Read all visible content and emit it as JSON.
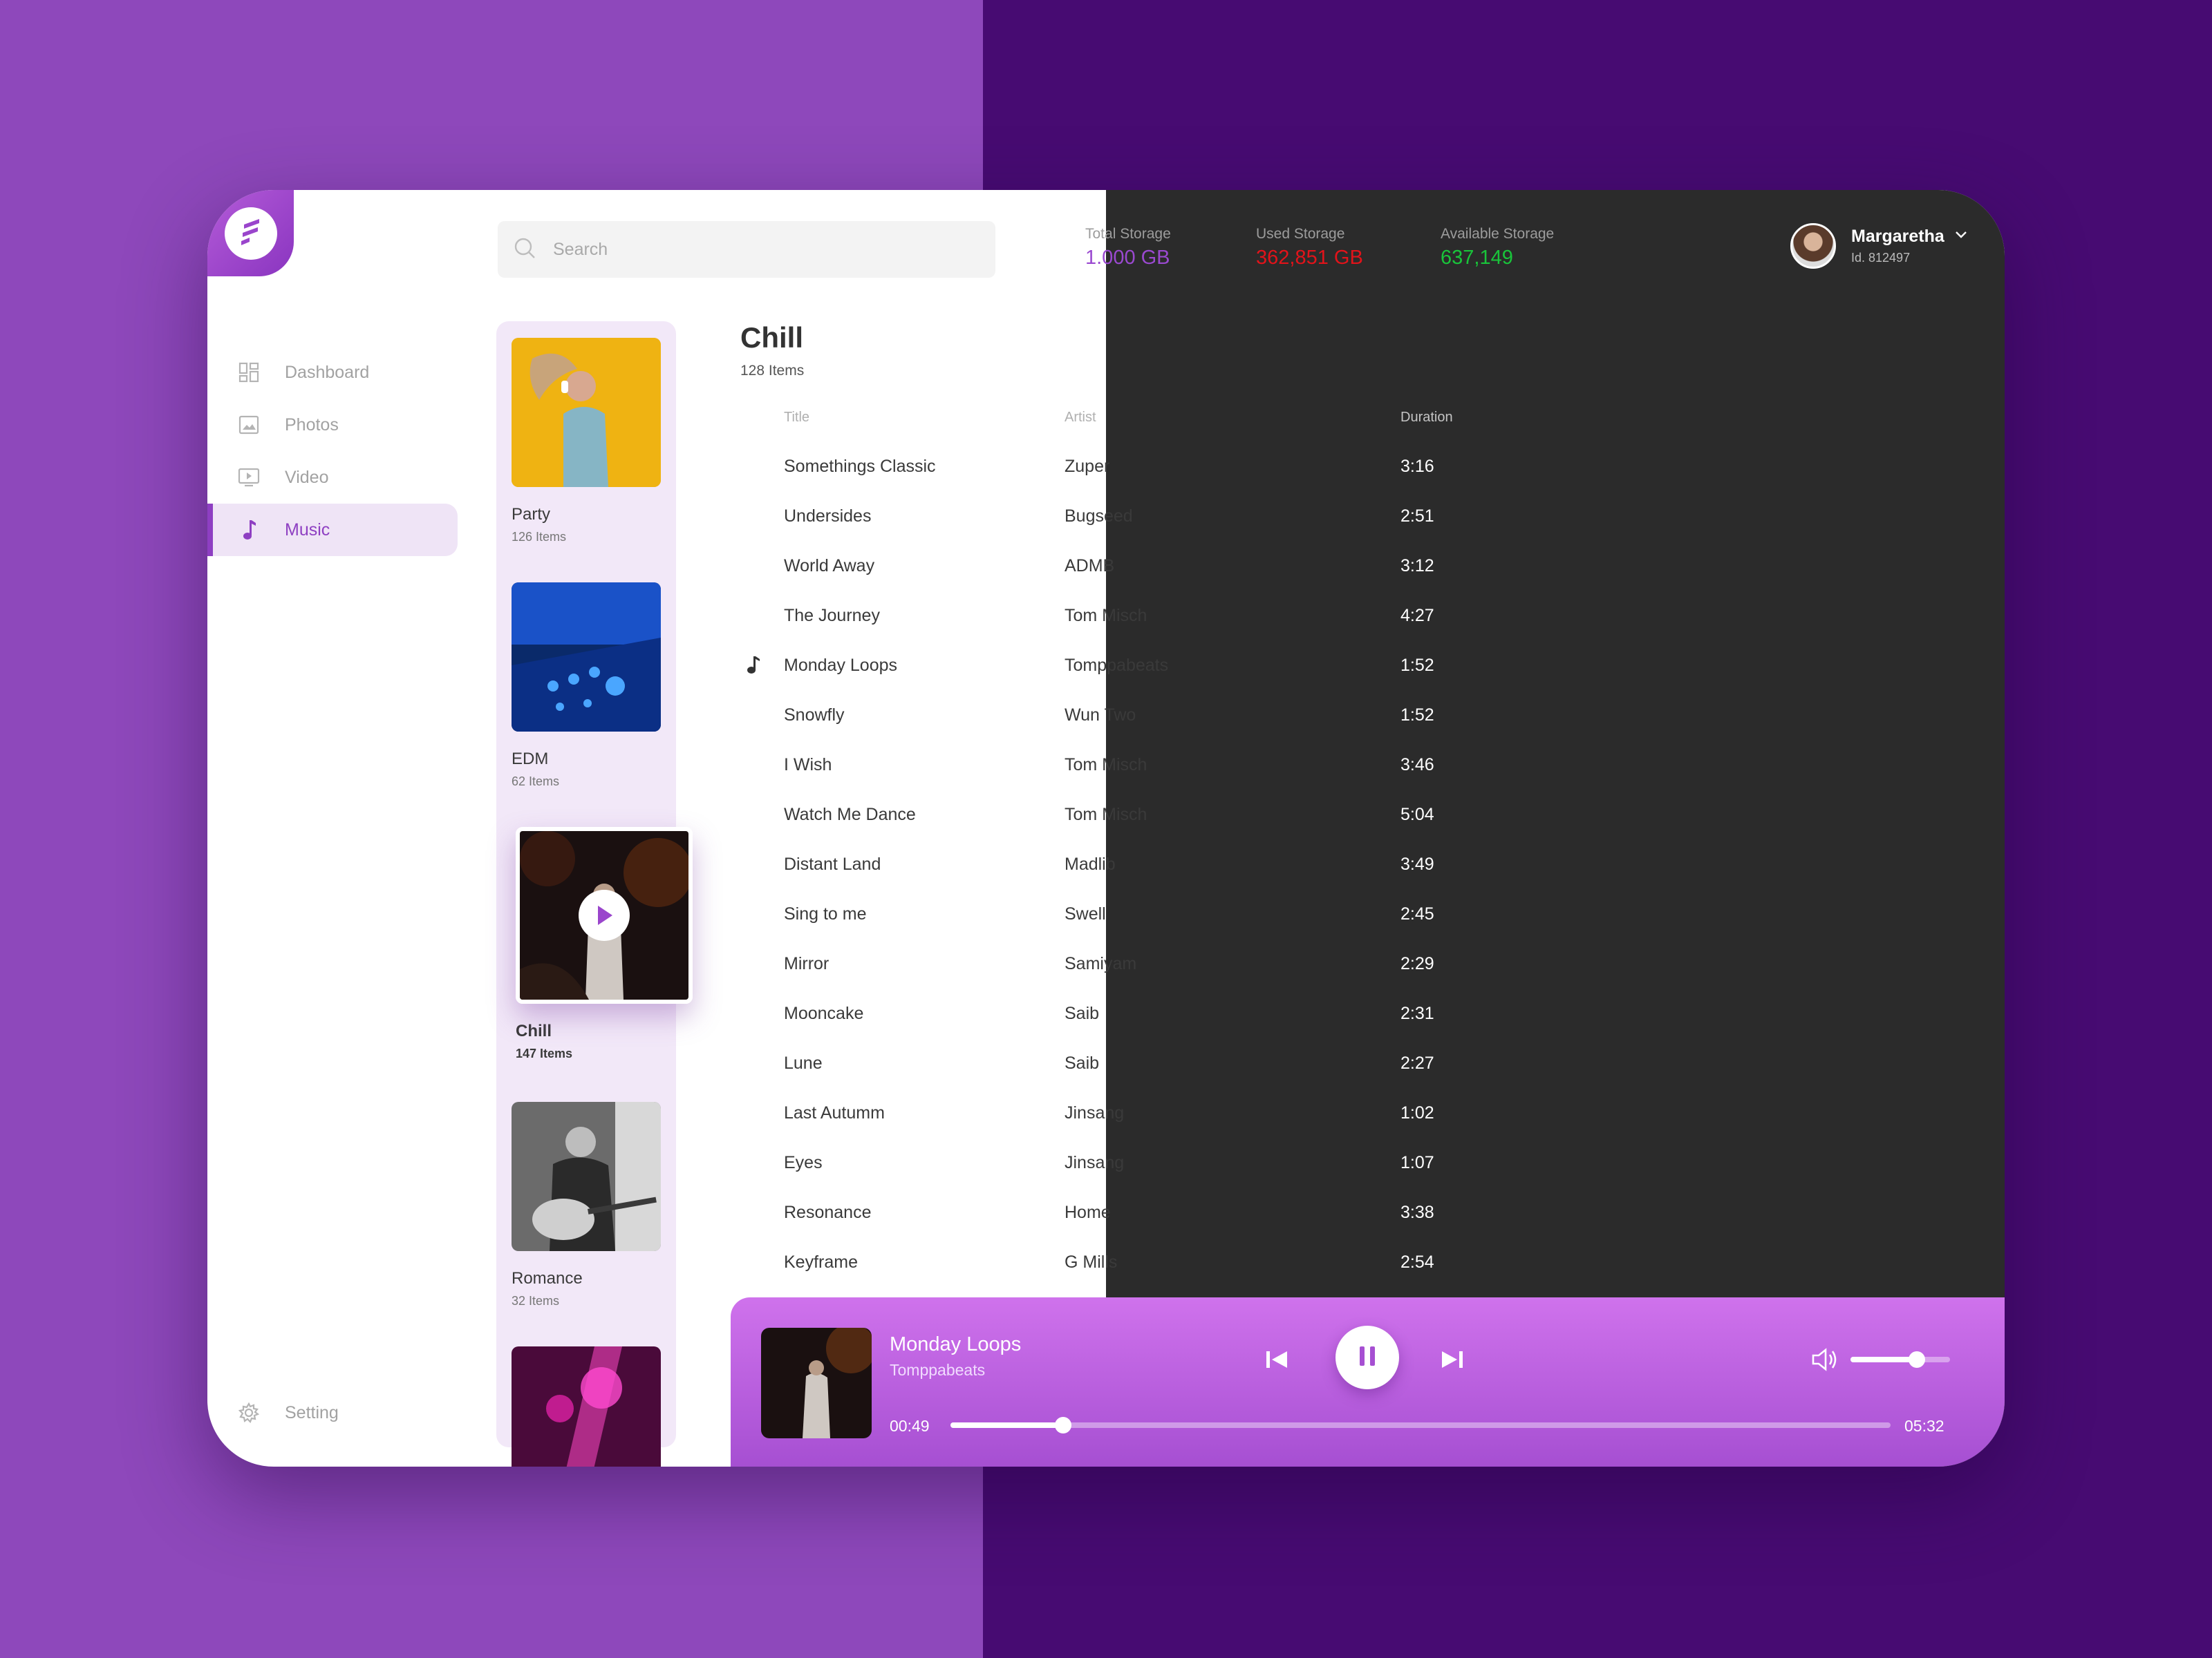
{
  "search": {
    "placeholder": "Search"
  },
  "storage": [
    {
      "label": "Total Storage",
      "value": "1.000 GB",
      "color": "#9a49d0"
    },
    {
      "label": "Used Storage",
      "value": "362,851 GB",
      "color": "#e2131a"
    },
    {
      "label": "Available Storage",
      "value": "637,149",
      "color": "#19c43a"
    }
  ],
  "user": {
    "name": "Margaretha",
    "id": "Id. 812497"
  },
  "sidebar": {
    "items": [
      {
        "label": "Dashboard",
        "icon": "dashboard-icon"
      },
      {
        "label": "Photos",
        "icon": "photo-icon"
      },
      {
        "label": "Video",
        "icon": "video-icon"
      },
      {
        "label": "Music",
        "icon": "music-note-icon",
        "active": true
      }
    ],
    "setting_label": "Setting"
  },
  "playlists": [
    {
      "name": "Party",
      "count": "126 Items"
    },
    {
      "name": "EDM",
      "count": "62 Items"
    },
    {
      "name": "Chill",
      "count": "147 Items",
      "featured": true
    },
    {
      "name": "Romance",
      "count": "32 Items"
    },
    {
      "name": "",
      "count": ""
    }
  ],
  "current": {
    "title": "Chill",
    "count": "128 Items",
    "columns": {
      "title": "Title",
      "artist": "Artist",
      "duration": "Duration"
    },
    "tracks": [
      {
        "title": "Somethings Classic",
        "artist": "Zuper",
        "duration": "3:16"
      },
      {
        "title": "Undersides",
        "artist": "Bugseed",
        "duration": "2:51"
      },
      {
        "title": "World Away",
        "artist": "ADMB",
        "duration": "3:12"
      },
      {
        "title": "The Journey",
        "artist": "Tom Misch",
        "duration": "4:27"
      },
      {
        "title": "Monday Loops",
        "artist": "Tomppabeats",
        "duration": "1:52",
        "playing": true
      },
      {
        "title": "Snowfly",
        "artist": "Wun Two",
        "duration": "1:52"
      },
      {
        "title": "I Wish",
        "artist": "Tom Misch",
        "duration": "3:46"
      },
      {
        "title": "Watch Me Dance",
        "artist": "Tom Misch",
        "duration": "5:04"
      },
      {
        "title": "Distant Land",
        "artist": "Madlib",
        "duration": "3:49"
      },
      {
        "title": "Sing to me",
        "artist": "Swell",
        "duration": "2:45"
      },
      {
        "title": "Mirror",
        "artist": "Samiyam",
        "duration": "2:29"
      },
      {
        "title": "Mooncake",
        "artist": "Saib",
        "duration": "2:31"
      },
      {
        "title": "Lune",
        "artist": "Saib",
        "duration": "2:27"
      },
      {
        "title": "Last Autumm",
        "artist": "Jinsang",
        "duration": "1:02"
      },
      {
        "title": "Eyes",
        "artist": "Jinsang",
        "duration": "1:07"
      },
      {
        "title": "Resonance",
        "artist": "Home",
        "duration": "3:38"
      },
      {
        "title": "Keyframe",
        "artist": "G Mills",
        "duration": "2:54"
      }
    ]
  },
  "player": {
    "title": "Monday Loops",
    "artist": "Tomppabeats",
    "elapsed": "00:49",
    "total": "05:32",
    "progress": 0.12,
    "volume": 0.67
  },
  "colors": {
    "accent": "#8e3fc2",
    "player_top": "#cf72ec",
    "player_bottom": "#a64fd2",
    "dark_panel": "#2b2b2b"
  }
}
